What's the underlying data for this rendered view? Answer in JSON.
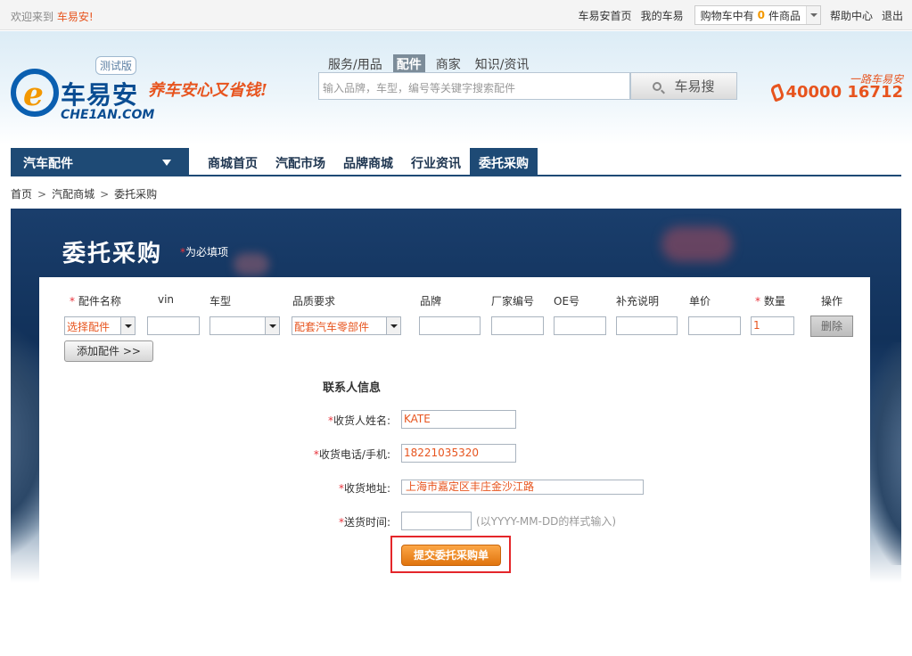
{
  "topbar": {
    "welcome_prefix": "欢迎来到",
    "welcome_brand": "车易安!",
    "links": [
      "车易安首页",
      "我的车易"
    ],
    "cart_prefix": "购物车中有",
    "cart_count": "0",
    "cart_suffix": "件商品",
    "help": "帮助中心",
    "logout": "退出"
  },
  "header": {
    "logo_cn": "车易安",
    "logo_en": "CHE1AN.COM",
    "beta": "测试版",
    "slogan": "养车安心又省钱!",
    "search_tabs": [
      {
        "label": "服务/用品",
        "active": false
      },
      {
        "label": "配件",
        "active": true
      },
      {
        "label": "商家",
        "active": false
      },
      {
        "label": "知识/资讯",
        "active": false
      }
    ],
    "search_placeholder": "输入品牌，车型，编号等关键字搜索配件",
    "search_button": "车易搜",
    "hotline_slogan": "一路车易安",
    "hotline": "40000 16712"
  },
  "nav": {
    "category": "汽车配件",
    "items": [
      {
        "label": "商城首页",
        "active": false
      },
      {
        "label": "汽配市场",
        "active": false
      },
      {
        "label": "品牌商城",
        "active": false
      },
      {
        "label": "行业资讯",
        "active": false
      },
      {
        "label": "委托采购",
        "active": true
      }
    ]
  },
  "breadcrumb": [
    "首页",
    "汽配商城",
    "委托采购"
  ],
  "breadcrumb_sep": ">",
  "page": {
    "title": "委托采购",
    "required_star": "*",
    "required_note": "为必填项"
  },
  "parts_table": {
    "required_star": "*",
    "headers": {
      "part_name": "配件名称",
      "vin": "vin",
      "model": "车型",
      "quality": "品质要求",
      "brand": "品牌",
      "oem_no": "厂家编号",
      "oe_no": "OE号",
      "remark": "补充说明",
      "price": "单价",
      "qty": "数量",
      "action": "操作"
    },
    "row": {
      "part_name": "选择配件",
      "vin": "",
      "model": "",
      "quality": "配套汽车零部件",
      "brand": "",
      "oem_no": "",
      "oe_no": "",
      "remark": "",
      "price": "",
      "qty": "1",
      "delete": "删除"
    },
    "add_button": "添加配件 >>"
  },
  "contact": {
    "title": "联系人信息",
    "required_star": "*",
    "fields": {
      "name_label": "收货人姓名:",
      "name_value": "KATE",
      "phone_label": "收货电话/手机:",
      "phone_value": "18221035320",
      "address_label": "收货地址:",
      "address_value": "上海市嘉定区丰庄金沙江路",
      "time_label": "送货时间:",
      "time_value": "",
      "time_hint": "(以YYYY-MM-DD的样式输入)"
    },
    "submit": "提交委托采购单"
  },
  "colors": {
    "accent": "#e7541e",
    "nav": "#1e4a75",
    "highlight_border": "#e4262a"
  }
}
